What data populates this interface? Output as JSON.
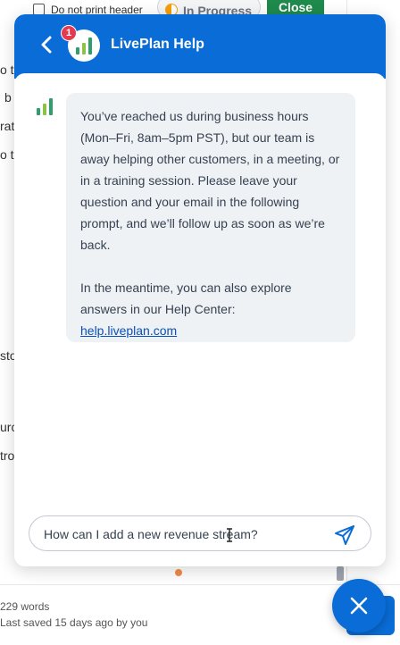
{
  "background": {
    "checkbox_label": "Do not print header",
    "status_label": "In Progress",
    "close_label": "Close",
    "snippets": [
      "o t",
      "b",
      "rat",
      "o t",
      "sto",
      "urc",
      "tro"
    ],
    "word_count": "229 words",
    "last_saved": "Last saved 15 days ago by you"
  },
  "chat": {
    "title": "LivePlan Help",
    "badge_count": "1",
    "message": {
      "paragraph1": "You’ve reached us during business hours (Mon–Fri, 8am–5pm PST), but our team is away helping other customers, in a meeting, or in a training session. Please leave your question and your email in the following prompt, and we’ll follow up as soon as we’re back.",
      "paragraph2": "In the meantime, you can also explore answers in our Help Center:",
      "link": "help.liveplan.com"
    },
    "input_value": "How can I add a new revenue stream?",
    "icons": {
      "back": "chevron-left-icon",
      "send": "paper-plane-icon",
      "close": "close-icon",
      "logo": "liveplan-bars-logo"
    }
  },
  "colors": {
    "header": "#0a6cd6",
    "badge": "#e53950",
    "bubble": "#eef2f5",
    "logo_green": "#8bc34a",
    "logo_teal": "#2e9e6b"
  }
}
